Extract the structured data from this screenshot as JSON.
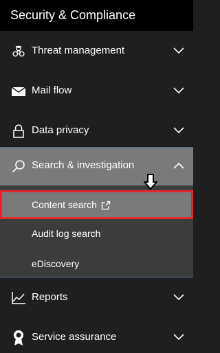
{
  "header": {
    "title": "Security & Compliance"
  },
  "nav": {
    "items": [
      {
        "label": "Threat management",
        "icon": "biohazard-icon"
      },
      {
        "label": "Mail flow",
        "icon": "envelope-icon"
      },
      {
        "label": "Data privacy",
        "icon": "lock-icon"
      },
      {
        "label": "Search & investigation",
        "icon": "search-icon",
        "expanded": true
      },
      {
        "label": "Reports",
        "icon": "chart-icon"
      },
      {
        "label": "Service assurance",
        "icon": "badge-icon"
      }
    ],
    "sub_items": [
      {
        "label": "Content search",
        "active": true,
        "external": true
      },
      {
        "label": "Audit log search"
      },
      {
        "label": "eDiscovery"
      }
    ]
  },
  "colors": {
    "background": "#1f1f1f",
    "title_bar": "#000000",
    "expanded_header": "#7a7a7a",
    "sub_area": "#3c3c3c",
    "highlight_border": "#e8242c"
  }
}
